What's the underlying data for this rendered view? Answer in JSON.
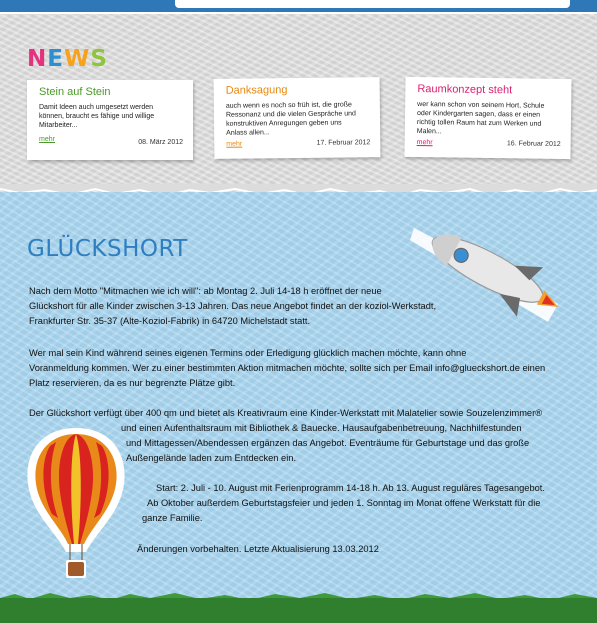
{
  "news": {
    "heading": [
      "N",
      "E",
      "W",
      "S"
    ],
    "cards": [
      {
        "title": "Stein auf Stein",
        "title_color": "#4a9a2a",
        "text": [
          "Damit Ideen auch umgesetzt werden",
          "können, braucht es fähige und willige",
          "Mitarbeiter..."
        ],
        "more": "mehr",
        "more_color": "#4a9a2a",
        "date": "08. März 2012"
      },
      {
        "title": "Danksagung",
        "title_color": "#e68a12",
        "text": [
          "auch wenn es noch so früh ist, die große",
          "Ressonanz und die vielen Gespräche und",
          "konstruktiven Anregungen geben uns",
          "Anlass allen..."
        ],
        "more": "mehr",
        "more_color": "#e68a12",
        "date": "17. Februar 2012"
      },
      {
        "title": "Raumkonzept steht",
        "title_color": "#d91f6f",
        "text": [
          "wer kann schon von seinem Hort, Schule",
          "oder Kindergarten sagen, dass er einen",
          "richtig tollen Raum hat zum Werken und",
          "Malen..."
        ],
        "more": "mehr",
        "more_color": "#d91f6f",
        "date": "16. Februar 2012"
      }
    ]
  },
  "main": {
    "heading": "GLÜCKSHORT",
    "p1": [
      "Nach dem Motto \"Mitmachen wie ich will\": ab Montag 2. Juli 14-18 h eröffnet der neue",
      "Glückshort für alle Kinder zwischen 3-13 Jahren. Das neue Angebot findet an der koziol-Werkstadt,",
      "Frankfurter Str. 35-37 (Alte-Koziol-Fabrik) in 64720 Michelstadt statt."
    ],
    "p2": [
      "Wer mal sein Kind während seines eigenen Termins oder Erledigung glücklich machen möchte, kann ohne",
      "Voranmeldung kommen. Wer zu einer bestimmten Aktion mitmachen möchte, sollte sich per Email info@glueckshort.de einen",
      "Platz reservieren, da es nur begrenzte Plätze gibt."
    ],
    "p3": [
      "Der Glückshort verfügt über 400 qm und bietet als Kreativraum eine Kinder-Werkstatt mit Malatelier sowie Souzelenzimmer®",
      "und einen Aufenthaltsraum mit Bibliothek & Bauecke. Hausaufgabenbetreuung, Nachhilfestunden",
      "und Mittagessen/Abendessen  ergänzen das Angebot. Eventräume für Geburtstage und das große",
      "Außengelände laden zum Entdecken ein."
    ],
    "p4": [
      "Start: 2. Juli - 10. August mit Ferienprogramm 14-18 h. Ab 13. August reguläres Tagesangebot.",
      "Ab Oktober außerdem Geburtstagsfeier und jeden 1. Sonntag im Monat offene Werkstatt für die",
      "ganze Familie."
    ],
    "p5": "Änderungen vorbehalten. Letzte Aktualisierung 13.03.2012"
  },
  "icons": {
    "rocket": "rocket-icon",
    "balloon": "hot-air-balloon-icon"
  },
  "colors": {
    "heading_blue": "#2f7fc0",
    "sky": "#a8d5f0",
    "grass": "#2f7f2f"
  }
}
